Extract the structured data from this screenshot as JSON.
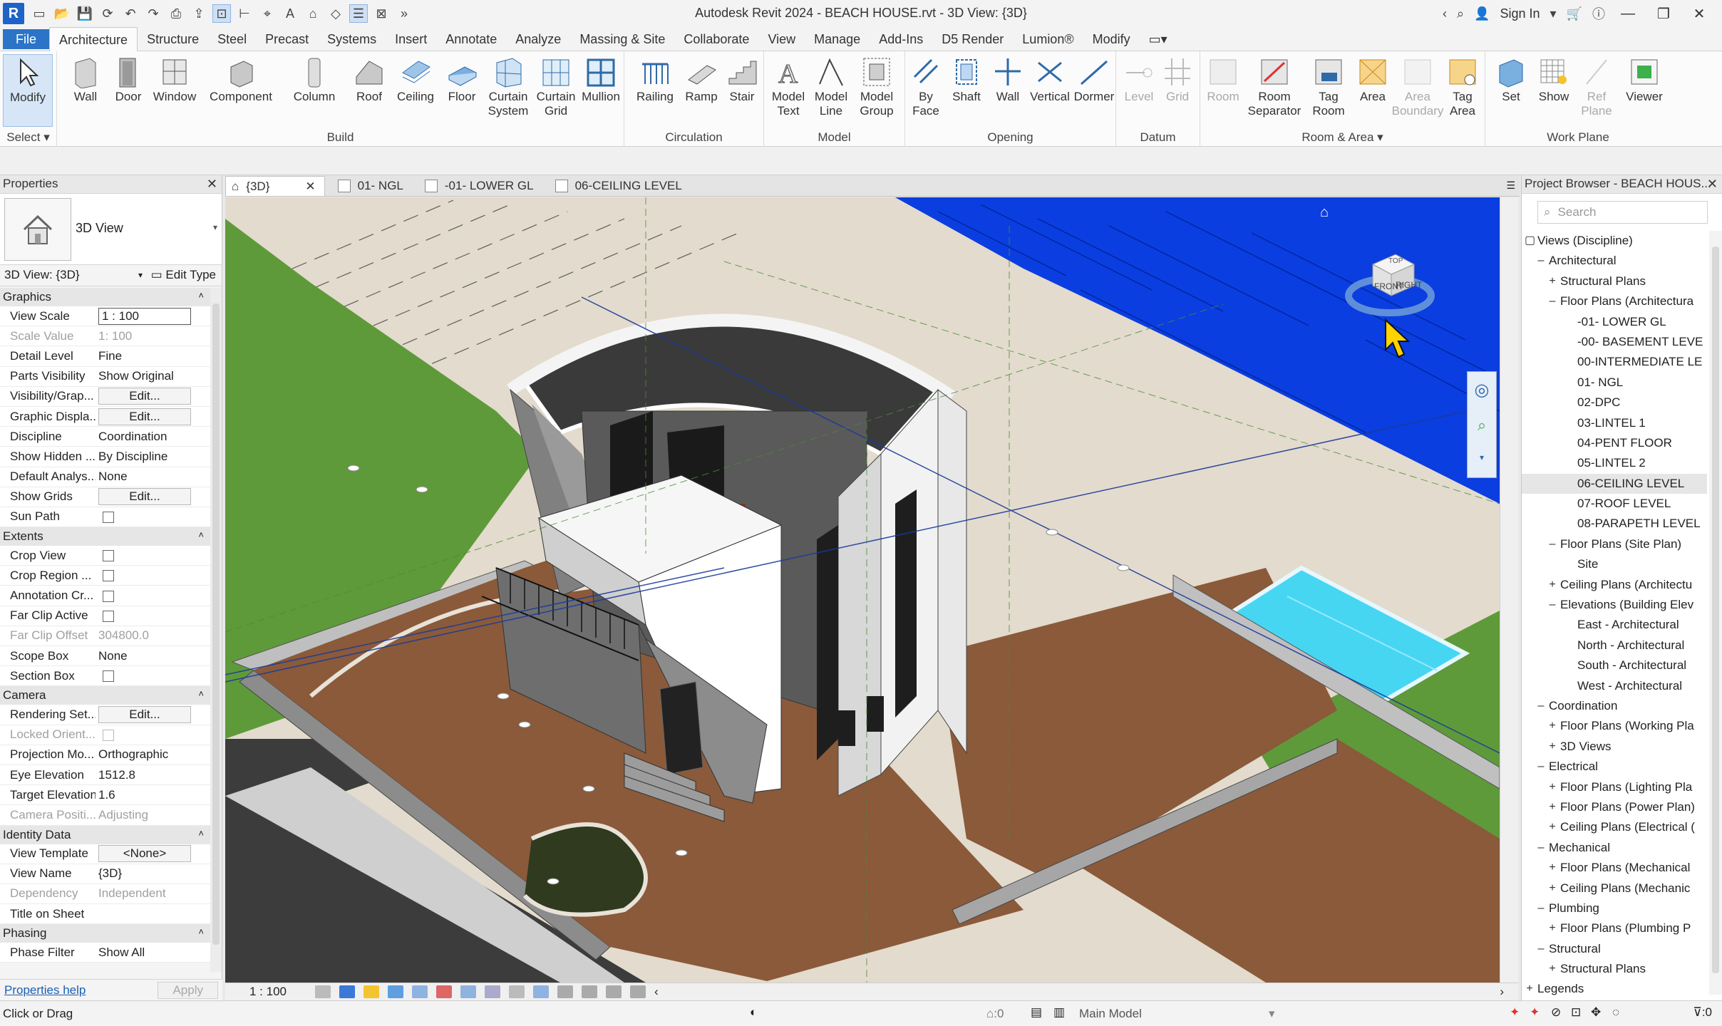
{
  "window": {
    "title": "Autodesk Revit 2024 - BEACH HOUSE.rvt - 3D View: {3D}",
    "sign_in": "Sign In",
    "app_letter": "R"
  },
  "ribbon_tabs": [
    "File",
    "Architecture",
    "Structure",
    "Steel",
    "Precast",
    "Systems",
    "Insert",
    "Annotate",
    "Analyze",
    "Massing & Site",
    "Collaborate",
    "View",
    "Manage",
    "Add-Ins",
    "D5 Render",
    "Lumion®",
    "Modify"
  ],
  "ribbon": {
    "select_label": "Select",
    "panels": {
      "build": "Build",
      "circulation": "Circulation",
      "model": "Model",
      "opening": "Opening",
      "datum": "Datum",
      "room_area": "Room & Area",
      "work_plane": "Work Plane"
    },
    "buttons": {
      "modify": "Modify",
      "wall": "Wall",
      "door": "Door",
      "window": "Window",
      "component": "Component",
      "column": "Column",
      "roof": "Roof",
      "ceiling": "Ceiling",
      "floor": "Floor",
      "curtain_system": "Curtain\nSystem",
      "curtain_grid": "Curtain\nGrid",
      "mullion": "Mullion",
      "railing": "Railing",
      "ramp": "Ramp",
      "stair": "Stair",
      "model_text": "Model\nText",
      "model_line": "Model\nLine",
      "model_group": "Model\nGroup",
      "by_face": "By\nFace",
      "shaft": "Shaft",
      "wall_opening": "Wall",
      "vertical": "Vertical",
      "dormer": "Dormer",
      "level": "Level",
      "grid": "Grid",
      "room": "Room",
      "room_separator": "Room\nSeparator",
      "tag_room": "Tag\nRoom",
      "area": "Area",
      "area_boundary": "Area\nBoundary",
      "tag_area": "Tag\nArea",
      "set": "Set",
      "show": "Show",
      "ref_plane": "Ref\nPlane",
      "viewer": "Viewer"
    }
  },
  "properties": {
    "title": "Properties",
    "type_name": "3D View",
    "selector": "3D View: {3D}",
    "edit_type": "Edit Type",
    "categories": {
      "graphics": "Graphics",
      "extents": "Extents",
      "camera": "Camera",
      "identity": "Identity Data",
      "phasing": "Phasing"
    },
    "rows": {
      "view_scale": {
        "name": "View Scale",
        "value": "1 : 100"
      },
      "scale_value": {
        "name": "Scale Value",
        "value": "1:  100"
      },
      "detail_level": {
        "name": "Detail Level",
        "value": "Fine"
      },
      "parts_visibility": {
        "name": "Parts Visibility",
        "value": "Show Original"
      },
      "visibility_graphics": {
        "name": "Visibility/Grap...",
        "value": "Edit..."
      },
      "graphic_display": {
        "name": "Graphic Displa...",
        "value": "Edit..."
      },
      "discipline": {
        "name": "Discipline",
        "value": "Coordination"
      },
      "show_hidden": {
        "name": "Show Hidden ...",
        "value": "By Discipline"
      },
      "default_analysis": {
        "name": "Default Analys...",
        "value": "None"
      },
      "show_grids": {
        "name": "Show Grids",
        "value": "Edit..."
      },
      "sun_path": {
        "name": "Sun Path",
        "value": ""
      },
      "crop_view": {
        "name": "Crop View",
        "value": ""
      },
      "crop_region": {
        "name": "Crop Region ...",
        "value": ""
      },
      "annotation_crop": {
        "name": "Annotation Cr...",
        "value": ""
      },
      "far_clip_active": {
        "name": "Far Clip Active",
        "value": ""
      },
      "far_clip_offset": {
        "name": "Far Clip Offset",
        "value": "304800.0"
      },
      "scope_box": {
        "name": "Scope Box",
        "value": "None"
      },
      "section_box": {
        "name": "Section Box",
        "value": ""
      },
      "rendering_settings": {
        "name": "Rendering Set...",
        "value": "Edit..."
      },
      "locked_orientation": {
        "name": "Locked Orient...",
        "value": ""
      },
      "projection_mode": {
        "name": "Projection Mo...",
        "value": "Orthographic"
      },
      "eye_elevation": {
        "name": "Eye Elevation",
        "value": "1512.8"
      },
      "target_elevation": {
        "name": "Target Elevation",
        "value": "1.6"
      },
      "camera_position": {
        "name": "Camera Positi...",
        "value": "Adjusting"
      },
      "view_template": {
        "name": "View Template",
        "value": "<None>"
      },
      "view_name": {
        "name": "View Name",
        "value": "{3D}"
      },
      "dependency": {
        "name": "Dependency",
        "value": "Independent"
      },
      "title_on_sheet": {
        "name": "Title on Sheet",
        "value": ""
      },
      "phase_filter": {
        "name": "Phase Filter",
        "value": "Show All"
      }
    },
    "help_link": "Properties help",
    "apply": "Apply"
  },
  "view_tabs": [
    "{3D}",
    "01- NGL",
    "-01- LOWER GL",
    "06-CEILING LEVEL"
  ],
  "viewcube": {
    "top": "TOP",
    "front": "FRONT",
    "right": "RIGHT"
  },
  "view_control_bar": {
    "scale": "1 : 100"
  },
  "browser": {
    "title": "Project Browser - BEACH HOUS...",
    "search_placeholder": "Search",
    "tree": [
      "Views (Discipline)",
      "Architectural",
      "Structural Plans",
      "Floor Plans (Architectura",
      "-01- LOWER GL",
      "-00- BASEMENT LEVE",
      "00-INTERMEDIATE LE",
      "01- NGL",
      "02-DPC",
      "03-LINTEL 1",
      "04-PENT FLOOR",
      "05-LINTEL 2",
      "06-CEILING LEVEL",
      "07-ROOF LEVEL",
      "08-PARAPETH LEVEL",
      "Floor Plans (Site Plan)",
      "Site",
      "Ceiling Plans (Architectu",
      "Elevations (Building Elev",
      "East - Architectural",
      "North - Architectural",
      "South - Architectural",
      "West - Architectural",
      "Coordination",
      "Floor Plans (Working Pla",
      "3D Views",
      "Electrical",
      "Floor Plans (Lighting Pla",
      "Floor Plans (Power Plan)",
      "Ceiling Plans (Electrical (",
      "Mechanical",
      "Floor Plans (Mechanical",
      "Ceiling Plans (Mechanic",
      "Plumbing",
      "Floor Plans (Plumbing P",
      "Structural",
      "Structural Plans",
      "Legends"
    ]
  },
  "status": {
    "hint": "Click or Drag",
    "workset_count": ":0",
    "model": "Main Model",
    "filter_count": ":0"
  },
  "colors": {
    "accent": "#2b74c7",
    "water": "#0a3ee0",
    "grass": "#5e9a3a",
    "pool": "#46d6f2"
  }
}
